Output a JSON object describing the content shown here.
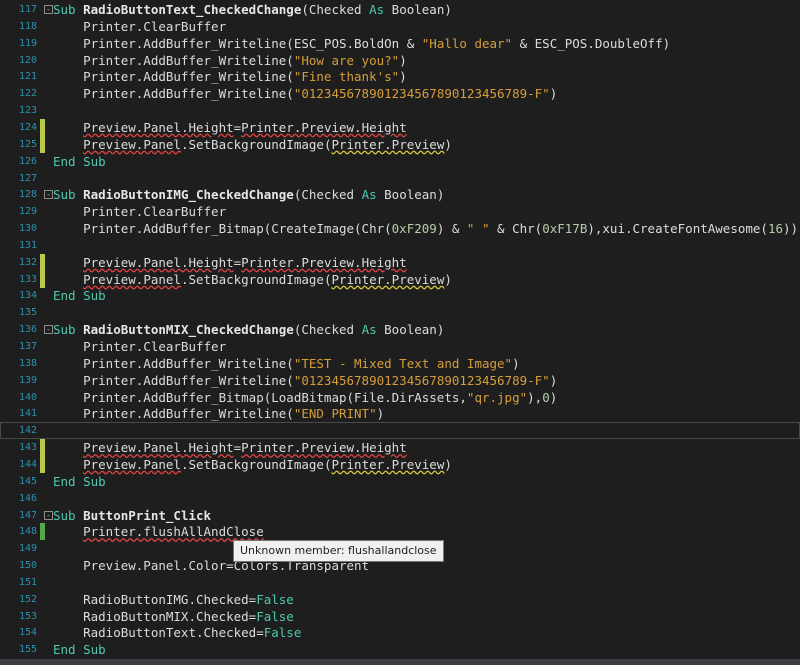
{
  "tooltip": "Unknown member: flushallandclose",
  "colors": {
    "background": "#1e1e1e",
    "line_numbers": "#2b91af",
    "keyword": "#4ec9b0",
    "string": "#d69d3b",
    "change_marker": "#b8c94e"
  },
  "lines": [
    {
      "n": "117",
      "fold": "⊟",
      "m": "",
      "s": [
        [
          "Sub ",
          "kw"
        ],
        [
          "RadioButtonText_CheckedChange",
          "bold"
        ],
        [
          "(Checked ",
          ""
        ],
        [
          "As ",
          "kw"
        ],
        [
          "Boolean",
          ""
        ],
        [
          ")",
          ""
        ]
      ]
    },
    {
      "n": "118",
      "m": "",
      "s": [
        [
          "    Printer.ClearBuffer",
          ""
        ]
      ]
    },
    {
      "n": "119",
      "m": "",
      "s": [
        [
          "    Printer.AddBuffer_Writeline(ESC_POS.BoldOn & ",
          ""
        ],
        [
          "\"Hallo dear\"",
          "str"
        ],
        [
          " & ESC_POS.DoubleOff)",
          ""
        ]
      ]
    },
    {
      "n": "120",
      "m": "",
      "s": [
        [
          "    Printer.AddBuffer_Writeline(",
          ""
        ],
        [
          "\"How are you?\"",
          "str"
        ],
        [
          ")",
          ""
        ]
      ]
    },
    {
      "n": "121",
      "m": "",
      "s": [
        [
          "    Printer.AddBuffer_Writeline(",
          ""
        ],
        [
          "\"Fine thank's\"",
          "str"
        ],
        [
          ")",
          ""
        ]
      ]
    },
    {
      "n": "122",
      "m": "",
      "s": [
        [
          "    Printer.AddBuffer_Writeline(",
          ""
        ],
        [
          "\"01234567890123456789012345678 9-F\"",
          "str"
        ],
        [
          ")",
          ""
        ]
      ]
    },
    {
      "n": "123",
      "m": "",
      "s": []
    },
    {
      "n": "124",
      "m": "changed",
      "s": [
        [
          "    ",
          ""
        ],
        [
          "Preview.Panel.Height",
          "err"
        ],
        [
          "=",
          ""
        ],
        [
          "Printer.Preview.Height",
          "err"
        ]
      ]
    },
    {
      "n": "125",
      "m": "changed",
      "s": [
        [
          "    ",
          ""
        ],
        [
          "Preview.Panel",
          "err"
        ],
        [
          ".SetBackgroundImage(",
          ""
        ],
        [
          "Printer.Preview",
          "warn"
        ],
        [
          ")",
          ""
        ]
      ]
    },
    {
      "n": "126",
      "m": "",
      "s": [
        [
          "End Sub",
          "kw"
        ]
      ]
    },
    {
      "n": "127",
      "m": "",
      "s": []
    },
    {
      "n": "128",
      "fold": "⊟",
      "m": "",
      "s": [
        [
          "Sub ",
          "kw"
        ],
        [
          "RadioButtonIMG_CheckedChange",
          "bold"
        ],
        [
          "(Checked ",
          ""
        ],
        [
          "As ",
          "kw"
        ],
        [
          "Boolean",
          ""
        ],
        [
          ")",
          ""
        ]
      ]
    },
    {
      "n": "129",
      "m": "",
      "s": [
        [
          "    Printer.ClearBuffer",
          ""
        ]
      ]
    },
    {
      "n": "130",
      "m": "",
      "s": [
        [
          "    Printer.AddBuffer_Bitmap(CreateImage(Chr(",
          ""
        ],
        [
          "0xF209",
          "num"
        ],
        [
          ") & ",
          ""
        ],
        [
          "\" \"",
          "str"
        ],
        [
          " & Chr(",
          ""
        ],
        [
          "0xF17B",
          "num"
        ],
        [
          "),xui.CreateFontAwesome(",
          ""
        ],
        [
          "16",
          "num"
        ],
        [
          ")),",
          ""
        ],
        [
          "0",
          "num"
        ],
        [
          ")",
          ""
        ]
      ]
    },
    {
      "n": "131",
      "m": "",
      "s": []
    },
    {
      "n": "132",
      "m": "changed",
      "s": [
        [
          "    ",
          ""
        ],
        [
          "Preview.Panel.Height",
          "err"
        ],
        [
          "=",
          ""
        ],
        [
          "Printer.Preview.Height",
          "err"
        ]
      ]
    },
    {
      "n": "133",
      "m": "changed",
      "s": [
        [
          "    ",
          ""
        ],
        [
          "Preview.Panel",
          "err"
        ],
        [
          ".SetBackgroundImage(",
          ""
        ],
        [
          "Printer.Preview",
          "warn"
        ],
        [
          ")",
          ""
        ]
      ]
    },
    {
      "n": "134",
      "m": "",
      "s": [
        [
          "End Sub",
          "kw"
        ]
      ]
    },
    {
      "n": "135",
      "m": "",
      "s": []
    },
    {
      "n": "136",
      "fold": "⊟",
      "m": "",
      "s": [
        [
          "Sub ",
          "kw"
        ],
        [
          "RadioButtonMIX_CheckedChange",
          "bold"
        ],
        [
          "(Checked ",
          ""
        ],
        [
          "As ",
          "kw"
        ],
        [
          "Boolean",
          ""
        ],
        [
          ")",
          ""
        ]
      ]
    },
    {
      "n": "137",
      "m": "",
      "s": [
        [
          "    Printer.ClearBuffer",
          ""
        ]
      ]
    },
    {
      "n": "138",
      "m": "",
      "s": [
        [
          "    Printer.AddBuffer_Writeline(",
          ""
        ],
        [
          "\"TEST - Mixed Text and Image\"",
          "str"
        ],
        [
          ")",
          ""
        ]
      ]
    },
    {
      "n": "139",
      "m": "",
      "s": [
        [
          "    Printer.AddBuffer_Writeline(",
          ""
        ],
        [
          "\"01234567890123456789012345678 9-F\"",
          "str"
        ],
        [
          ")",
          ""
        ]
      ]
    },
    {
      "n": "140",
      "m": "",
      "s": [
        [
          "    Printer.AddBuffer_Bitmap(LoadBitmap(File.DirAssets,",
          ""
        ],
        [
          "\"qr.jpg\"",
          "str"
        ],
        [
          "),",
          ""
        ],
        [
          "0",
          "num"
        ],
        [
          ")",
          ""
        ]
      ]
    },
    {
      "n": "141",
      "m": "",
      "s": [
        [
          "    Printer.AddBuffer_Writeline(",
          ""
        ],
        [
          "\"END PRINT\"",
          "str"
        ],
        [
          ")",
          ""
        ]
      ]
    },
    {
      "n": "142",
      "m": "",
      "caret": true,
      "s": []
    },
    {
      "n": "143",
      "m": "changed",
      "s": [
        [
          "    ",
          ""
        ],
        [
          "Preview.Panel.Height",
          "err"
        ],
        [
          "=",
          ""
        ],
        [
          "Printer.Preview.Height",
          "err"
        ]
      ]
    },
    {
      "n": "144",
      "m": "changed",
      "s": [
        [
          "    ",
          ""
        ],
        [
          "Preview.Panel",
          "err"
        ],
        [
          ".SetBackgroundImage(",
          ""
        ],
        [
          "Printer.Preview",
          "warn"
        ],
        [
          ")",
          ""
        ]
      ]
    },
    {
      "n": "145",
      "m": "",
      "s": [
        [
          "End Sub",
          "kw"
        ]
      ]
    },
    {
      "n": "146",
      "m": "",
      "s": []
    },
    {
      "n": "147",
      "fold": "⊟",
      "m": "",
      "s": [
        [
          "Sub ",
          "kw"
        ],
        [
          "ButtonPrint_Click",
          "bold"
        ]
      ]
    },
    {
      "n": "148",
      "m": "saved",
      "s": [
        [
          "    ",
          ""
        ],
        [
          "Printer.flushAllAndClose",
          "err"
        ]
      ]
    },
    {
      "n": "149",
      "m": "",
      "s": []
    },
    {
      "n": "150",
      "m": "",
      "s": [
        [
          "    Preview.Panel.Color=Colors.Transparent",
          ""
        ]
      ]
    },
    {
      "n": "151",
      "m": "",
      "s": []
    },
    {
      "n": "152",
      "m": "",
      "s": [
        [
          "    RadioButtonIMG.Checked=",
          ""
        ],
        [
          "False",
          "kw"
        ]
      ]
    },
    {
      "n": "153",
      "m": "",
      "s": [
        [
          "    RadioButtonMIX.Checked=",
          ""
        ],
        [
          "False",
          "kw"
        ]
      ]
    },
    {
      "n": "154",
      "m": "",
      "s": [
        [
          "    RadioButtonText.Checked=",
          ""
        ],
        [
          "False",
          "kw"
        ]
      ]
    },
    {
      "n": "155",
      "m": "",
      "s": [
        [
          "End Sub",
          "kw"
        ]
      ]
    }
  ]
}
